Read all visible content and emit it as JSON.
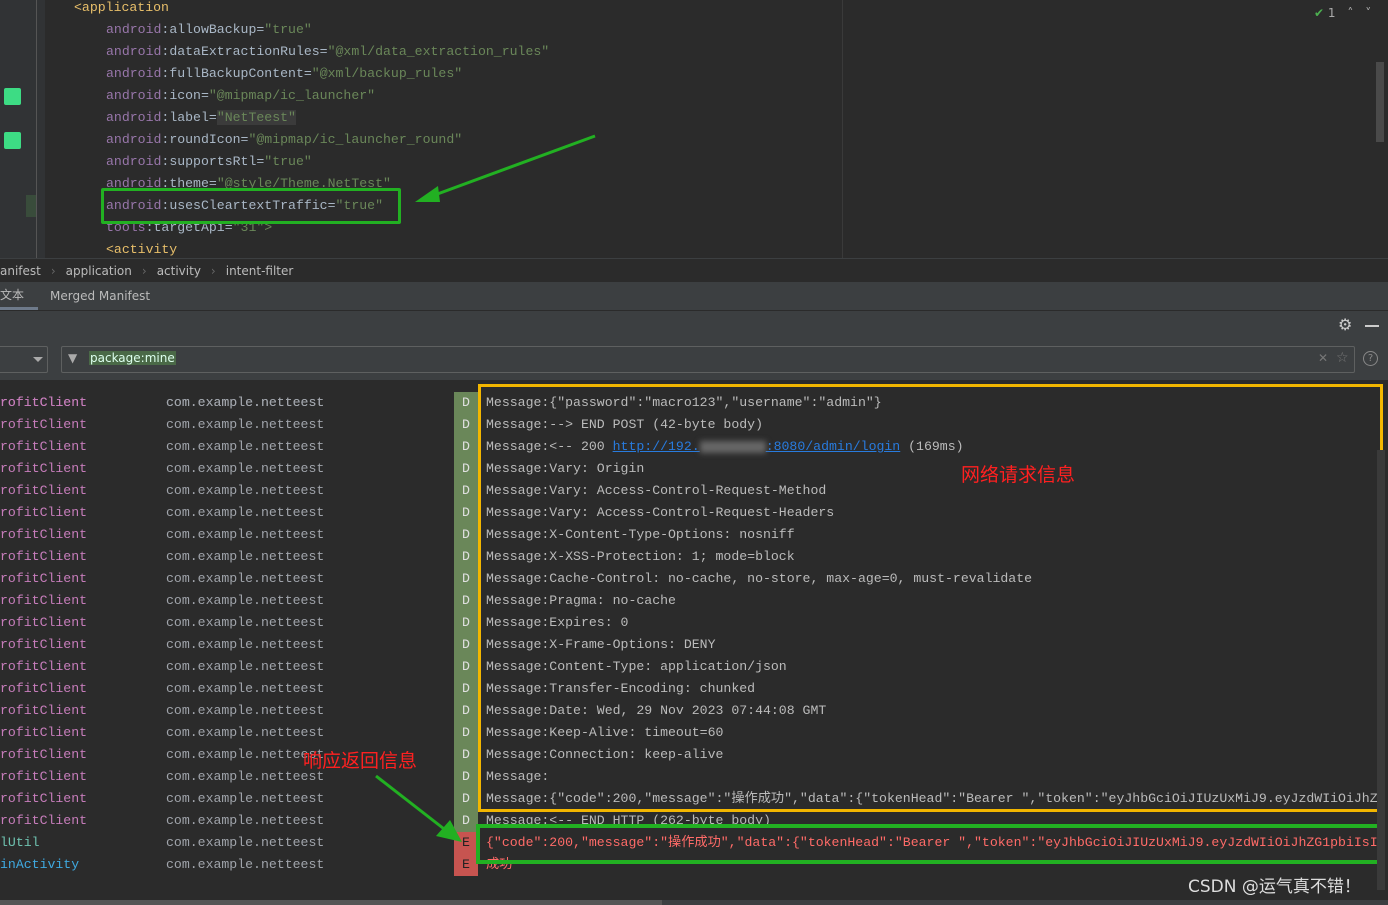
{
  "editor": {
    "lines": [
      {
        "tag": "<application"
      },
      {
        "attr": "android",
        "name": ":allowBackup=",
        "value": "\"true\""
      },
      {
        "attr": "android",
        "name": ":dataExtractionRules=",
        "value": "\"@xml/data_extraction_rules\""
      },
      {
        "attr": "android",
        "name": ":fullBackupContent=",
        "value": "\"@xml/backup_rules\""
      },
      {
        "attr": "android",
        "name": ":icon=",
        "value": "\"@mipmap/ic_launcher\""
      },
      {
        "attr": "android",
        "name": ":label=",
        "value": "\"NetTeest\""
      },
      {
        "attr": "android",
        "name": ":roundIcon=",
        "value": "\"@mipmap/ic_launcher_round\""
      },
      {
        "attr": "android",
        "name": ":supportsRtl=",
        "value": "\"true\""
      },
      {
        "attr": "android",
        "name": ":theme=",
        "value": "\"@style/Theme.NetTest\""
      },
      {
        "attr": "android",
        "name": ":usesCleartextTraffic=",
        "value": "\"true\""
      },
      {
        "attr": "tools",
        "name": ":targetApi=",
        "value": "\"31\">"
      },
      {
        "tag": "<activity"
      }
    ],
    "inspection_count": "1"
  },
  "breadcrumb": [
    "anifest",
    "application",
    "activity",
    "intent-filter"
  ],
  "tabs": [
    {
      "label": "文本",
      "active": true
    },
    {
      "label": "Merged Manifest",
      "active": false
    }
  ],
  "filter": {
    "value": "package:mine"
  },
  "log": {
    "tags": [
      "rofitClient",
      "lUtil",
      "inActivity"
    ],
    "package": "com.example.netteest",
    "rows": [
      {
        "tag": "rofitClient",
        "level": "D",
        "msg": "Message:{\"password\":\"macro123\",\"username\":\"admin\"}"
      },
      {
        "tag": "rofitClient",
        "level": "D",
        "msg": "Message:--> END POST (42-byte body)"
      },
      {
        "tag": "rofitClient",
        "level": "D",
        "msg": "Message:<-- 200 ",
        "link": "http://192.",
        "link2": ":8080/admin/login",
        "after": " (169ms)"
      },
      {
        "tag": "rofitClient",
        "level": "D",
        "msg": "Message:Vary: Origin"
      },
      {
        "tag": "rofitClient",
        "level": "D",
        "msg": "Message:Vary: Access-Control-Request-Method"
      },
      {
        "tag": "rofitClient",
        "level": "D",
        "msg": "Message:Vary: Access-Control-Request-Headers"
      },
      {
        "tag": "rofitClient",
        "level": "D",
        "msg": "Message:X-Content-Type-Options: nosniff"
      },
      {
        "tag": "rofitClient",
        "level": "D",
        "msg": "Message:X-XSS-Protection: 1; mode=block"
      },
      {
        "tag": "rofitClient",
        "level": "D",
        "msg": "Message:Cache-Control: no-cache, no-store, max-age=0, must-revalidate"
      },
      {
        "tag": "rofitClient",
        "level": "D",
        "msg": "Message:Pragma: no-cache"
      },
      {
        "tag": "rofitClient",
        "level": "D",
        "msg": "Message:Expires: 0"
      },
      {
        "tag": "rofitClient",
        "level": "D",
        "msg": "Message:X-Frame-Options: DENY"
      },
      {
        "tag": "rofitClient",
        "level": "D",
        "msg": "Message:Content-Type: application/json"
      },
      {
        "tag": "rofitClient",
        "level": "D",
        "msg": "Message:Transfer-Encoding: chunked"
      },
      {
        "tag": "rofitClient",
        "level": "D",
        "msg": "Message:Date: Wed, 29 Nov 2023 07:44:08 GMT"
      },
      {
        "tag": "rofitClient",
        "level": "D",
        "msg": "Message:Keep-Alive: timeout=60"
      },
      {
        "tag": "rofitClient",
        "level": "D",
        "msg": "Message:Connection: keep-alive"
      },
      {
        "tag": "rofitClient",
        "level": "D",
        "msg": "Message:"
      },
      {
        "tag": "rofitClient",
        "level": "D",
        "msg": "Message:{\"code\":200,\"message\":\"操作成功\",\"data\":{\"tokenHead\":\"Bearer \",\"token\":\"eyJhbGciOiJIUzUxMiJ9.eyJzdWIiOiJhZ"
      },
      {
        "tag": "rofitClient",
        "level": "D",
        "msg": "Message:<-- END HTTP (262-byte body)"
      },
      {
        "tag": "lUtil",
        "level": "E",
        "msg": "{\"code\":200,\"message\":\"操作成功\",\"data\":{\"tokenHead\":\"Bearer \",\"token\":\"eyJhbGciOiJIUzUxMiJ9.eyJzdWIiOiJhZG1pbiIsI"
      },
      {
        "tag": "inActivity",
        "level": "E",
        "msg": "成功"
      }
    ]
  },
  "annotations": {
    "request": "网络请求信息",
    "response": "响应返回信息",
    "watermark": "CSDN @运气真不错！"
  },
  "colors": {
    "debug": "#6a8759",
    "error": "#c75450",
    "highlight_green": "#22b022",
    "highlight_yellow": "#f2b600",
    "annotation": "#ff2020"
  }
}
